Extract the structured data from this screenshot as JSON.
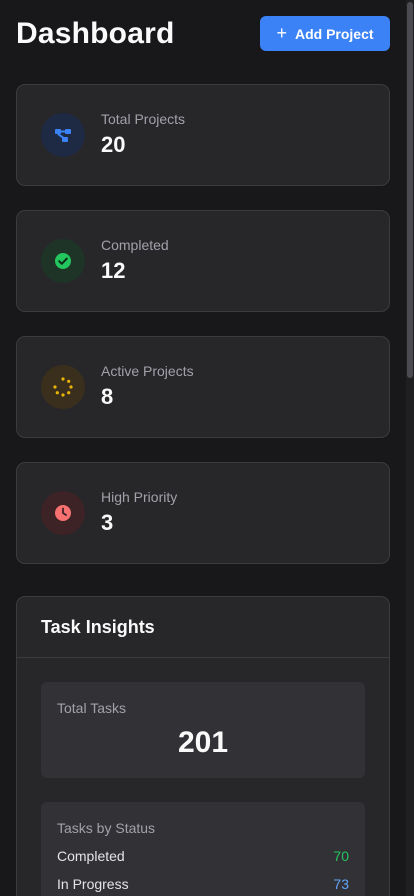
{
  "header": {
    "title": "Dashboard",
    "add_button": {
      "icon": "plus-icon",
      "label": "Add Project"
    }
  },
  "stats": [
    {
      "label": "Total Projects",
      "value": "20",
      "icon": "project-graph-icon",
      "icon_color": "#3b82f6",
      "icon_bg": "#1e2a44"
    },
    {
      "label": "Completed",
      "value": "12",
      "icon": "check-circle-icon",
      "icon_color": "#22c55e",
      "icon_bg": "#1e3427"
    },
    {
      "label": "Active Projects",
      "value": "8",
      "icon": "spinner-icon",
      "icon_color": "#eab308",
      "icon_bg": "#3a2f1c"
    },
    {
      "label": "High Priority",
      "value": "3",
      "icon": "clock-icon",
      "icon_color": "#f87171",
      "icon_bg": "#3d2226"
    }
  ],
  "insights": {
    "title": "Task Insights",
    "total_label": "Total Tasks",
    "total_value": "201",
    "status_title": "Tasks by Status",
    "status_rows": [
      {
        "label": "Completed",
        "value": "70",
        "color": "#22c55e"
      },
      {
        "label": "In Progress",
        "value": "73",
        "color": "#60a5fa"
      }
    ]
  }
}
